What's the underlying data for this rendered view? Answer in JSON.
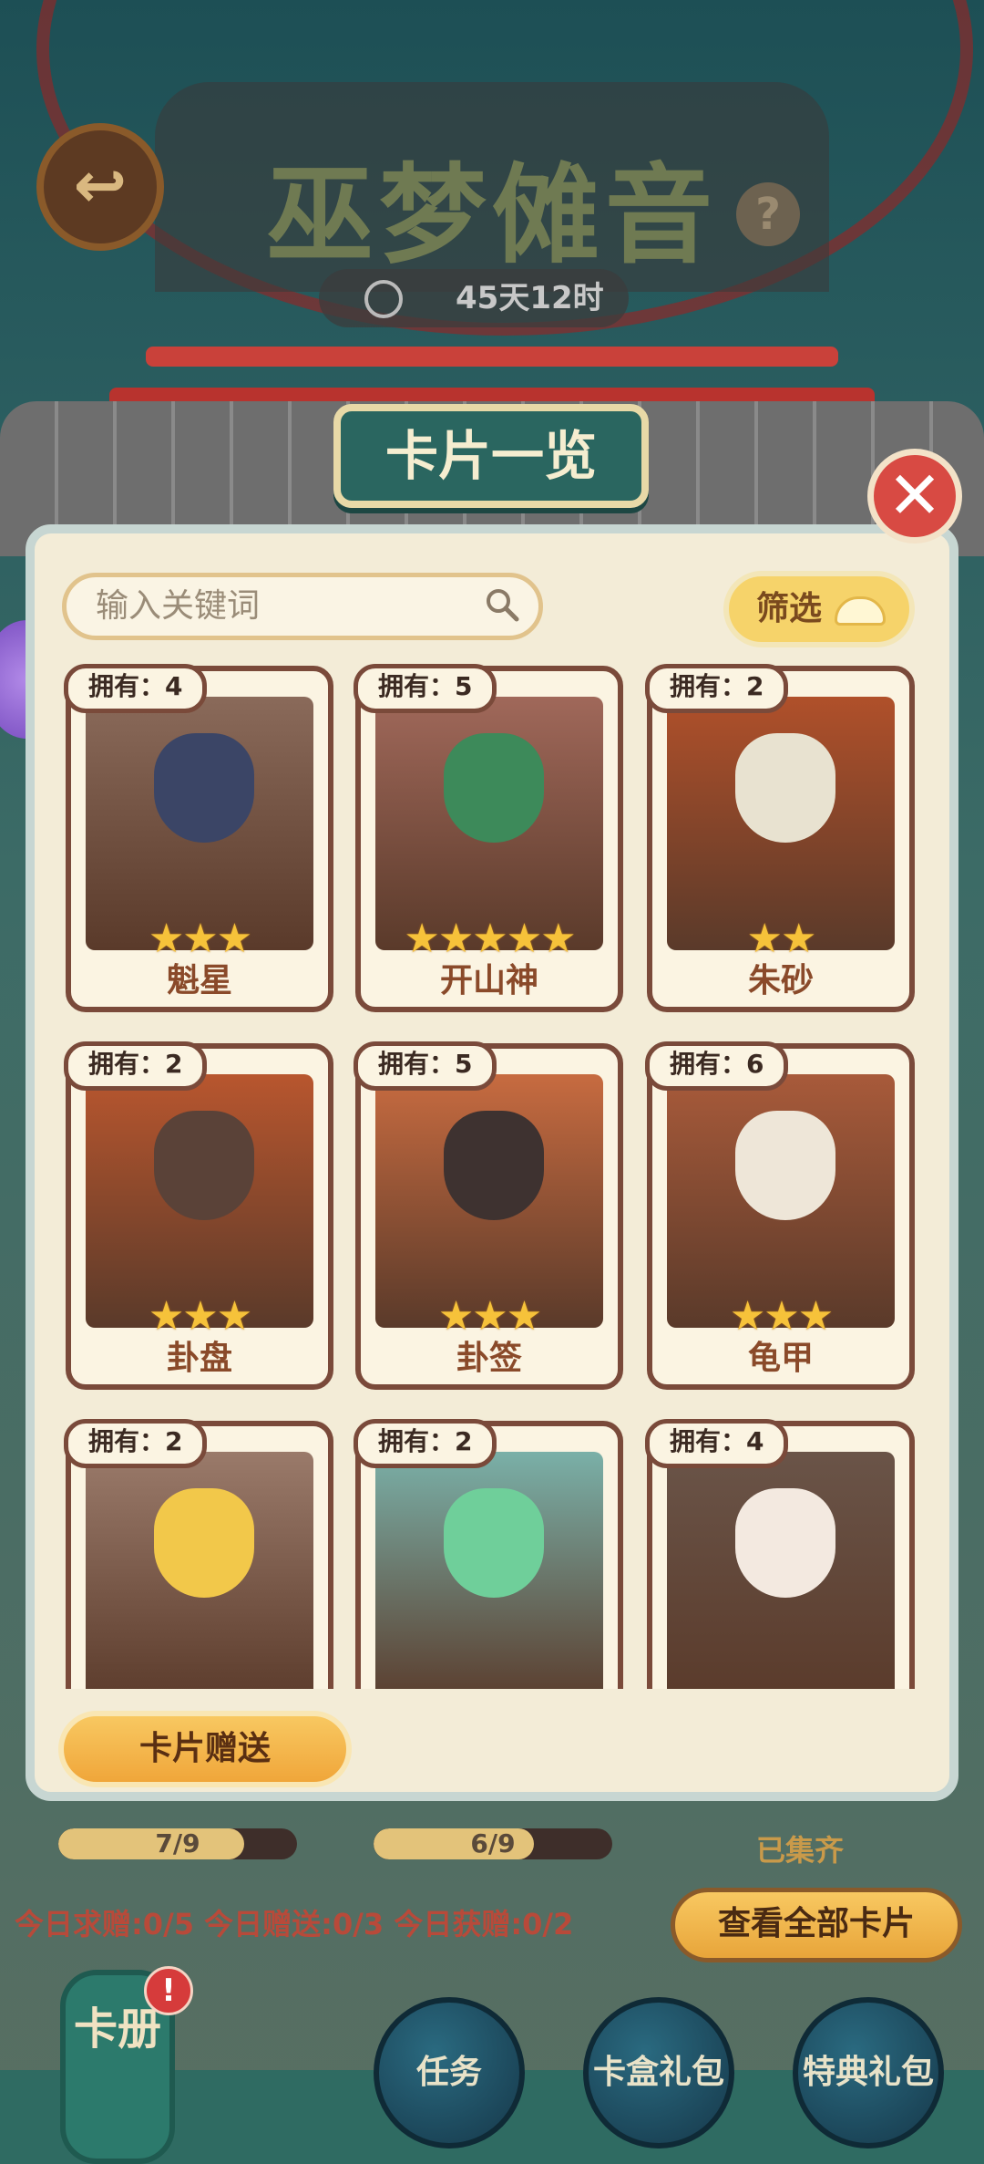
{
  "event": {
    "title": "巫梦傩音",
    "timer": "45天12时"
  },
  "panel": {
    "title": "卡片一览",
    "search_placeholder": "输入关键词",
    "filter_label": "筛选",
    "gift_button": "卡片赠送"
  },
  "cards": [
    {
      "owned": "拥有：4",
      "name": "魁星",
      "stars": "★★★",
      "bg": "#8a6a5a",
      "face": "#3b4566"
    },
    {
      "owned": "拥有：5",
      "name": "开山神",
      "stars": "★★★★★",
      "bg": "#a0685a",
      "face": "#3d8a5a"
    },
    {
      "owned": "拥有：2",
      "name": "朱砂",
      "stars": "★★",
      "bg": "#b0502a",
      "face": "#e8e2d0"
    },
    {
      "owned": "拥有：2",
      "name": "卦盘",
      "stars": "★★★",
      "bg": "#b8562e",
      "face": "#5a4238"
    },
    {
      "owned": "拥有：5",
      "name": "卦签",
      "stars": "★★★",
      "bg": "#c76b40",
      "face": "#3e3230"
    },
    {
      "owned": "拥有：6",
      "name": "龟甲",
      "stars": "★★★",
      "bg": "#a85a3a",
      "face": "#eee6d8"
    },
    {
      "owned": "拥有：2",
      "name": "",
      "stars": "",
      "bg": "#9a7a6a",
      "face": "#f2c84a"
    },
    {
      "owned": "拥有：2",
      "name": "",
      "stars": "",
      "bg": "#7ab0a8",
      "face": "#6fcf9a"
    },
    {
      "owned": "拥有：4",
      "name": "",
      "stars": "",
      "bg": "#6a5448",
      "face": "#f3e9e0"
    }
  ],
  "progress": [
    {
      "text": "7/9",
      "fraction": 0.78
    },
    {
      "text": "6/9",
      "fraction": 0.67
    }
  ],
  "collected_label": "已集齐",
  "stats": "今日求赠:0/5 今日赠送:0/3 今日获赠:0/2",
  "view_all": "查看全部卡片",
  "nav": {
    "lantern": "卡册",
    "badge": "!",
    "tasks": "任务",
    "card_pack": "卡盒礼包",
    "special_pack": "特典礼包"
  }
}
